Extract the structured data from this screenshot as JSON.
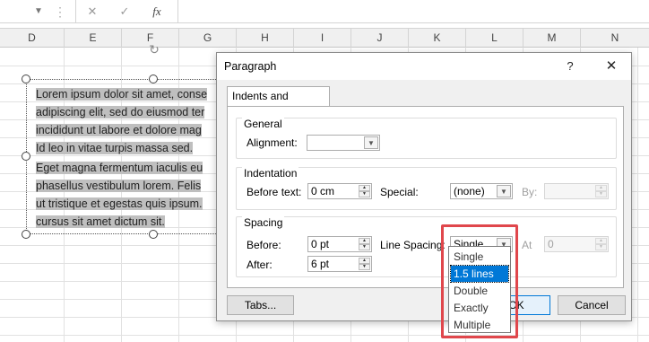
{
  "formula_bar": {
    "cancel_icon": "✕",
    "enter_icon": "✓",
    "fx_label": "fx"
  },
  "columns": [
    "D",
    "E",
    "F",
    "G",
    "H",
    "I",
    "J",
    "K",
    "L",
    "M",
    "N"
  ],
  "textbox": {
    "paragraph1": "Lorem ipsum dolor sit amet, consectetur adipiscing elit, sed do eiusmod tempor incididunt ut labore et dolore magna. Id leo in vitae turpis massa sed.",
    "p1_lines": [
      "Lorem ipsum dolor sit amet, conse",
      "adipiscing elit, sed do eiusmod ter",
      "incididunt ut labore et dolore mag",
      "Id leo in vitae turpis massa sed."
    ],
    "p2_lines": [
      "Eget magna fermentum iaculis eu",
      "phasellus vestibulum lorem. Felis",
      "ut tristique et egestas quis ipsum.",
      "cursus sit amet dictum sit."
    ]
  },
  "dialog": {
    "title": "Paragraph",
    "help": "?",
    "close": "✕",
    "tab_label": "Indents and Spacing",
    "general": {
      "title": "General",
      "alignment_label": "Alignment:",
      "alignment_value": ""
    },
    "indentation": {
      "title": "Indentation",
      "before_text_label": "Before text:",
      "before_text_value": "0 cm",
      "special_label": "Special:",
      "special_value": "(none)",
      "by_label": "By:",
      "by_value": ""
    },
    "spacing": {
      "title": "Spacing",
      "before_label": "Before:",
      "before_value": "0 pt",
      "after_label": "After:",
      "after_value": "6 pt",
      "line_spacing_label": "Line Spacing:",
      "line_spacing_value": "Single",
      "at_label": "At",
      "at_value": "0"
    },
    "line_spacing_options": [
      "Single",
      "1.5 lines",
      "Double",
      "Exactly",
      "Multiple"
    ],
    "highlighted_option": "1.5 lines",
    "tabs_button": "Tabs...",
    "ok_button": "OK",
    "cancel_button": "Cancel"
  }
}
